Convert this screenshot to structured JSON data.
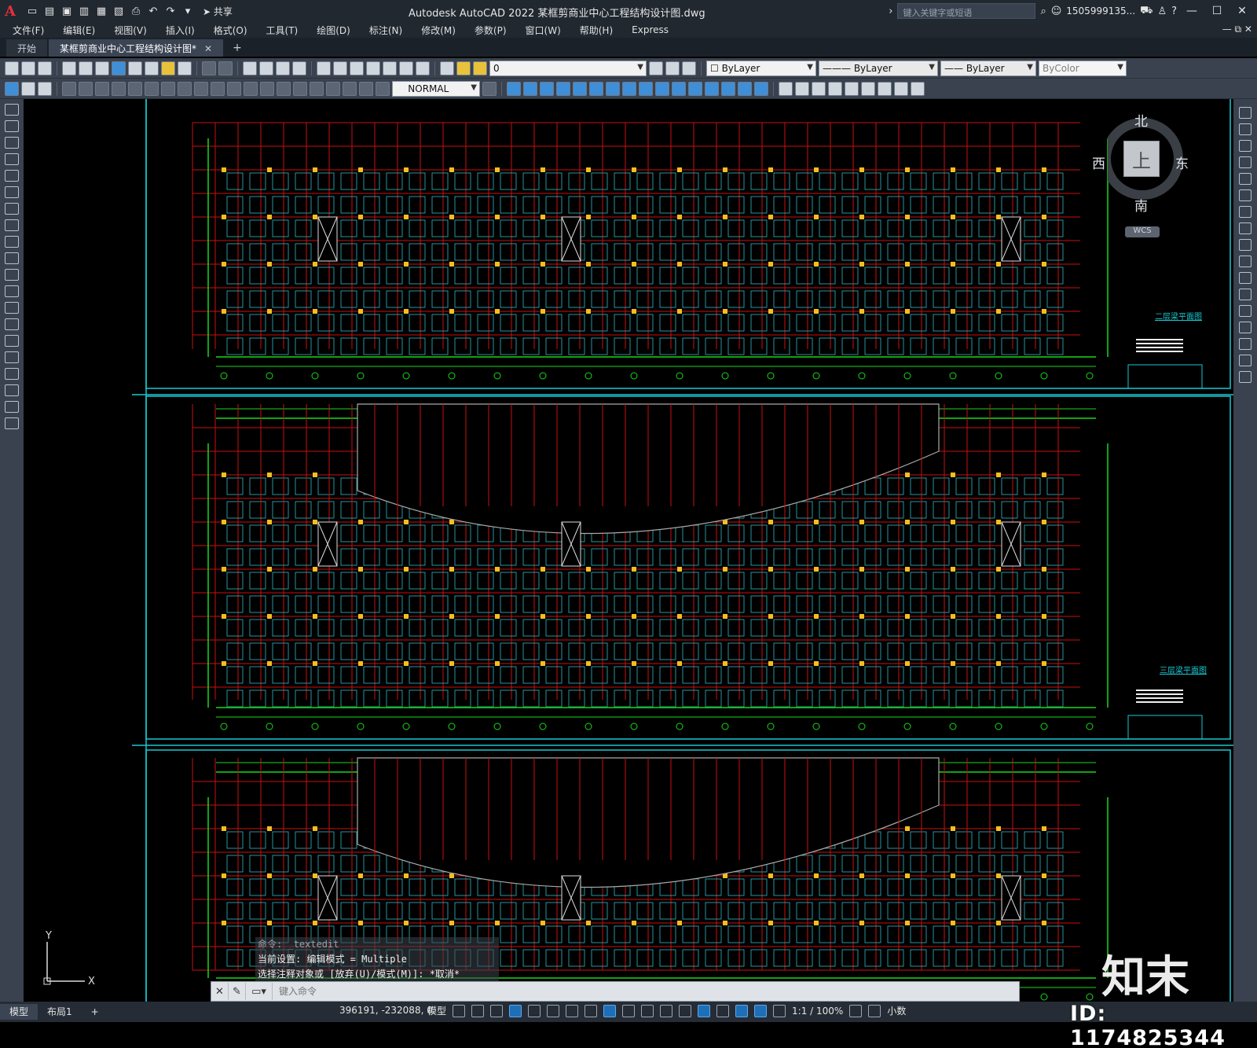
{
  "app": {
    "title": "Autodesk AutoCAD 2022    某框剪商业中心工程结构设计图.dwg",
    "search_placeholder": "键入关键字或短语",
    "username": "1505999135...",
    "share_label": "共享"
  },
  "menu": {
    "items": [
      "文件(F)",
      "编辑(E)",
      "视图(V)",
      "插入(I)",
      "格式(O)",
      "工具(T)",
      "绘图(D)",
      "标注(N)",
      "修改(M)",
      "参数(P)",
      "窗口(W)",
      "帮助(H)",
      "Express"
    ]
  },
  "tabs": {
    "start": "开始",
    "document": "某框剪商业中心工程结构设计图*"
  },
  "toolbar": {
    "layer_value": "0",
    "color_value": "ByLayer",
    "linetype_value": "ByLayer",
    "lineweight_value": "ByLayer",
    "plotstyle_value": "ByColor",
    "textstyle_value": "NORMAL"
  },
  "viewcube": {
    "north": "北",
    "south": "南",
    "east": "东",
    "west": "西",
    "face": "上",
    "wcs": "WCS"
  },
  "command": {
    "history": [
      "命令: _textedit",
      "当前设置: 编辑模式 = Multiple",
      "选择注释对象或 [放弃(U)/模式(M)]: *取消*"
    ],
    "placeholder": "键入命令"
  },
  "statusbar": {
    "layout_tabs": [
      "模型",
      "布局1"
    ],
    "add_tab": "+",
    "coordinates": "396191, -232088, 0",
    "model_label": "模型",
    "scale": "1:1 / 100%",
    "units": "小数"
  },
  "drawing": {
    "title_label": "二层梁平面图",
    "title_label_2": "三层梁平面图"
  },
  "watermark": {
    "logo": "知末",
    "id": "ID: 1174825344"
  },
  "colors": {
    "background": "#000000",
    "grid_red": "#c81010",
    "beam_cyan": "#2fb9c4",
    "axis_green": "#18d818",
    "column_yellow": "#f0c020",
    "frame_cyan": "#19c8d2"
  }
}
